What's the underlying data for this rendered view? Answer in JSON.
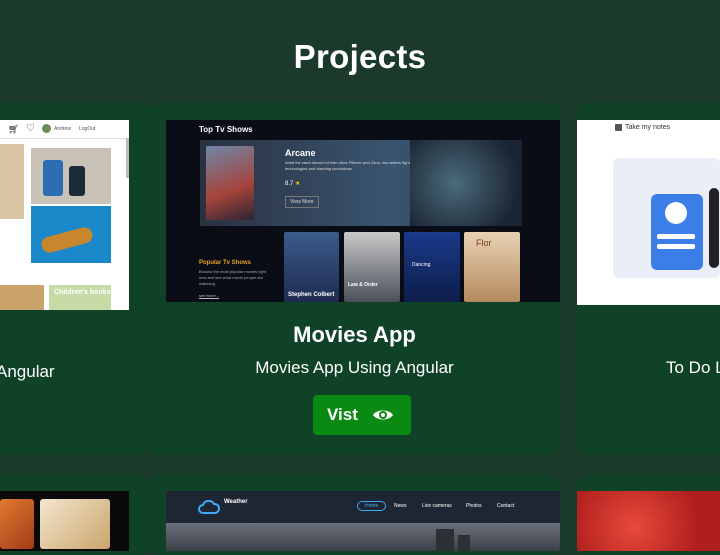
{
  "page": {
    "title": "Projects"
  },
  "projects": [
    {
      "name": "",
      "description": "Angular",
      "thumb": {
        "user": "Andrew",
        "logout": "LogOut",
        "section": "Children's books"
      }
    },
    {
      "name": "Movies App",
      "description": "Movies App Using Angular",
      "visit_label": "Vist",
      "thumb": {
        "top_heading": "Top Tv Shows",
        "feature_title": "Arcane",
        "feature_text": "Amid the stark discord of twin cities Piltover and Zaun, two sisters fight on rival sides of a war between magic technologies and clashing convictions.",
        "rating": "8.7",
        "more_label": "View More",
        "popular_heading": "Popular Tv Shows",
        "popular_text": "Browse the most popular movies right now and see what movie people are watching.",
        "popular_more": "see More...",
        "posters": [
          "Stephen Colbert",
          "Law & Order",
          "Dancing",
          "Flor"
        ]
      }
    },
    {
      "name": "",
      "description": "To Do L",
      "thumb": {
        "brand": "Take my notes"
      }
    }
  ],
  "bottom_row": {
    "weather": {
      "brand": "Weather",
      "nav": [
        "Home",
        "News",
        "Live cameras",
        "Photos",
        "Contact"
      ]
    }
  },
  "colors": {
    "background": "#1b3a2b",
    "card": "#0f4226",
    "visit": "#0a8a12"
  },
  "icons": {
    "visit": "eye-icon",
    "cart": "cart-icon",
    "wishlist": "heart-icon"
  }
}
